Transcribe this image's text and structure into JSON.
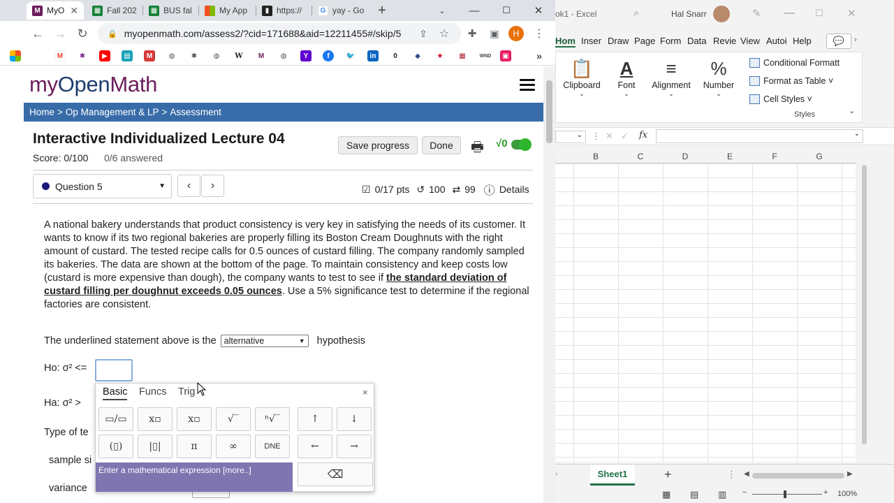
{
  "browser": {
    "tabs": [
      {
        "label": "MyO",
        "fav": "M",
        "color": "#6b1d5c",
        "active": true
      },
      {
        "label": "Fall 202",
        "fav": "▦",
        "color": "#188038"
      },
      {
        "label": "BUS fal",
        "fav": "▦",
        "color": "#188038"
      },
      {
        "label": "My App",
        "fav": "■",
        "color": "#f25022"
      },
      {
        "label": "https://",
        "fav": "▮",
        "color": "#222222"
      },
      {
        "label": "yay - Go",
        "fav": "G",
        "color": "#4285f4"
      }
    ],
    "new_tab": "+",
    "url": "myopenmath.com/assess2/?cid=171688&aid=12211455#/skip/5",
    "profile_initial": "H",
    "bookmarks": [
      "M",
      "✱",
      "▶",
      "▤",
      "M",
      "◍",
      "✱",
      "◍",
      "W",
      "M",
      "◍",
      "Y",
      "f",
      "🐦",
      "in",
      "0",
      "◆",
      "★",
      "▦",
      "WND",
      "▣"
    ],
    "bookmarks_more": "»"
  },
  "page": {
    "logo_my": "my",
    "logo_open": "Open",
    "logo_math": "Math",
    "breadcrumb": [
      "Home",
      ">",
      "Op Management & LP",
      ">",
      "Assessment"
    ],
    "title": "Interactive Individualized Lecture 04",
    "score": "Score: 0/100",
    "answered": "0/6 answered",
    "save_label": "Save progress",
    "done_label": "Done",
    "toggle_label": "√0",
    "question_label": "Question 5",
    "prev": "‹",
    "next": "›",
    "points": "0/17 pts",
    "retries": "100",
    "attempts": "99",
    "details": "Details",
    "question_text_1": "A national bakery understands that product consistency is very key in satisfying the needs of its customer. It wants to know if its two regional bakeries are properly filling its Boston Cream Doughnuts with the right amount of custard. The tested recipe calls for 0.5 ounces of custard filling. The company randomly sampled its bakeries. The data are shown at the bottom of the page. To maintain consistency and keep costs low (custard is more expensive than dough), the company wants to test to see if ",
    "question_text_underlined": "the standard deviation of custard filling per doughnut exceeds 0.05 ounces",
    "question_text_2": ". Use a 5% significance test to determine if the regional factories are consistent.",
    "hyp_prefix": "The underlined statement above is the",
    "hyp_selected": "alternative",
    "hyp_suffix": "hypothesis",
    "ho_label": "Ho: σ² <=",
    "ha_label": "Ha: σ² >",
    "type_label": "Type of te",
    "sample_label": "sample si",
    "variance_label": "variance"
  },
  "keypad": {
    "tabs": [
      "Basic",
      "Funcs",
      "Trig"
    ],
    "close": "×",
    "row1": [
      "▭/▭",
      "x▫",
      "x▫",
      "√‾",
      "ⁿ√‾",
      "↑",
      "↓"
    ],
    "row2": [
      "(▯)",
      "|▯|",
      "π",
      "∞",
      "DNE",
      "←",
      "→"
    ],
    "hint": "Enter a mathematical expression [more..]",
    "backspace": "⌫"
  },
  "excel": {
    "title": "ok1 - Excel",
    "user": "Hal Snarr",
    "ribbon_tabs": [
      "Hom",
      "Inser",
      "Draw",
      "Page",
      "Form",
      "Data",
      "Revie",
      "View",
      "Autoi",
      "Help"
    ],
    "groups": [
      "Clipboard",
      "Font",
      "Alignment",
      "Number"
    ],
    "styles": [
      "Conditional Formatt",
      "Format as Table ˅",
      "Cell Styles ˅"
    ],
    "styles_label": "Styles",
    "fx": "fx",
    "columns": [
      "B",
      "C",
      "D",
      "E",
      "F",
      "G"
    ],
    "sheet": "Sheet1",
    "add_sheet": "+",
    "zoom": "100%"
  }
}
